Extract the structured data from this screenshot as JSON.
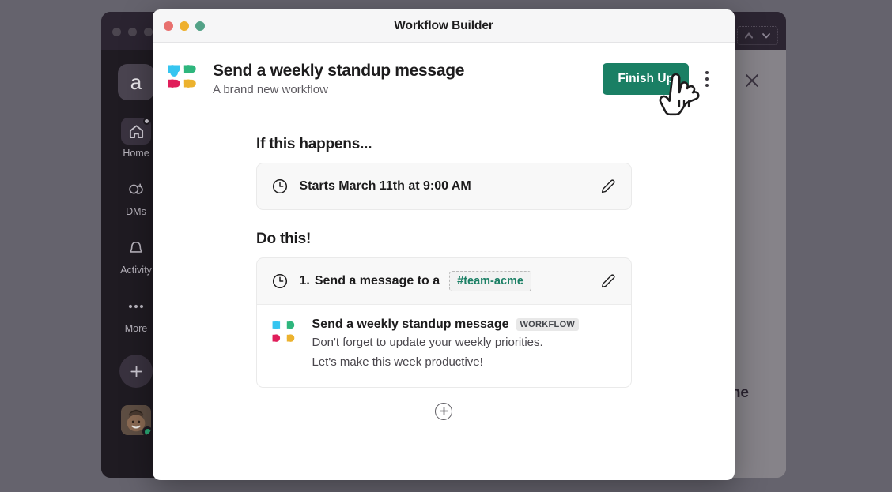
{
  "slack_window": {
    "workspace_avatar_letter": "a",
    "topbar_icons": [
      "caret-up-icon",
      "chevron-down-icon"
    ],
    "rail_items": [
      {
        "label": "Home",
        "icon": "home-icon",
        "active": true,
        "badge": true
      },
      {
        "label": "DMs",
        "icon": "dms-icon",
        "active": false,
        "badge": false
      },
      {
        "label": "Activity",
        "icon": "bell-icon",
        "active": false,
        "badge": false
      },
      {
        "label": "More",
        "icon": "ellipsis-icon",
        "active": false,
        "badge": false
      }
    ],
    "new_button_icon": "plus-icon",
    "user_avatar": "user-avatar",
    "scrim_close_icon": "close-icon",
    "scrim_partial_text": "ne",
    "scrim_send_icon": "send-icon"
  },
  "modal": {
    "titlebar": {
      "title": "Workflow Builder",
      "traffic_lights": [
        "close",
        "minimize",
        "zoom"
      ],
      "colors": {
        "close": "#e8706e",
        "minimize": "#eeb02e",
        "zoom": "#53a287"
      }
    },
    "header": {
      "logo": "slack-workflow-logo",
      "title": "Send a weekly standup message",
      "subtitle": "A brand new workflow",
      "primary_button": {
        "label": "Finish Up",
        "color": "#1a7f64"
      },
      "overflow_menu_icon": "kebab-menu-icon",
      "cursor": "pointing-hand-cursor"
    },
    "trigger_section": {
      "heading": "If this happens...",
      "icon": "clock-icon",
      "label": "Starts March 11th at 9:00 AM",
      "edit_icon": "pencil-icon"
    },
    "steps_section": {
      "heading": "Do this!",
      "step": {
        "icon": "clock-icon",
        "number": "1.",
        "label": "Send a message to a",
        "chip": "#team-acme",
        "chip_color": "#1a7f64",
        "edit_icon": "pencil-icon"
      },
      "preview": {
        "logo": "slack-workflow-logo",
        "sender": "Send a weekly standup message",
        "badge": "WORKFLOW",
        "lines": [
          "Don't forget to update your weekly priorities.",
          "Let's make this week productive!"
        ]
      },
      "add_step_icon": "plus-circle-icon"
    }
  },
  "brand_colors": {
    "slack_blue": "#36c5f0",
    "slack_green": "#2eb67d",
    "slack_red": "#e01e5a",
    "slack_yellow": "#ecb22e",
    "accent_green": "#1a7f64",
    "sidebar_dark": "#1f1b22"
  }
}
